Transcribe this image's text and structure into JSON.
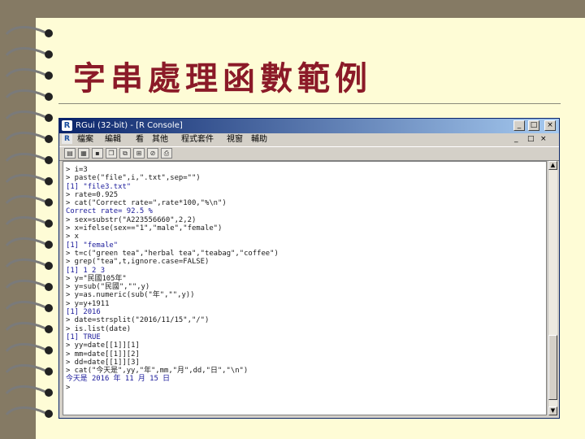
{
  "slide": {
    "title": "字串處理函數範例"
  },
  "window": {
    "title": "RGui (32-bit) - [R Console]",
    "controls": [
      "_",
      "□",
      "×"
    ],
    "inner_controls": [
      "_",
      "□",
      "×"
    ]
  },
  "menu": {
    "items": [
      "檔案",
      "編輯",
      "看",
      "其他",
      "程式套件",
      "視窗",
      "輔助"
    ]
  },
  "console": {
    "lines": [
      "> i=3",
      "> paste(\"file\",i,\".txt\",sep=\"\")",
      "[1] \"file3.txt\"",
      "> rate=0.925",
      "> cat(\"Correct rate=\",rate*100,\"%\\n\")",
      "Correct rate= 92.5 %",
      "> sex=substr(\"A223556660\",2,2)",
      "> x=ifelse(sex==\"1\",\"male\",\"female\")",
      "> x",
      "[1] \"female\"",
      "> t=c(\"green tea\",\"herbal tea\",\"teabag\",\"coffee\")",
      "> grep(\"tea\",t,ignore.case=FALSE)",
      "[1] 1 2 3",
      "> y=\"民國105年\"",
      "> y=sub(\"民國\",\"\",y)",
      "> y=as.numeric(sub(\"年\",\"\",y))",
      "> y=y+1911",
      "[1] 2016",
      "> date=strsplit(\"2016/11/15\",\"/\")",
      "> is.list(date)",
      "[1] TRUE",
      "> yy=date[[1]][1]",
      "> mm=date[[1]][2]",
      "> dd=date[[1]][3]",
      "> cat(\"今天是\",yy,\"年\",mm,\"月\",dd,\"日\",\"\\n\")",
      "今天是 2016 年 11 月 15 日",
      ">"
    ]
  }
}
